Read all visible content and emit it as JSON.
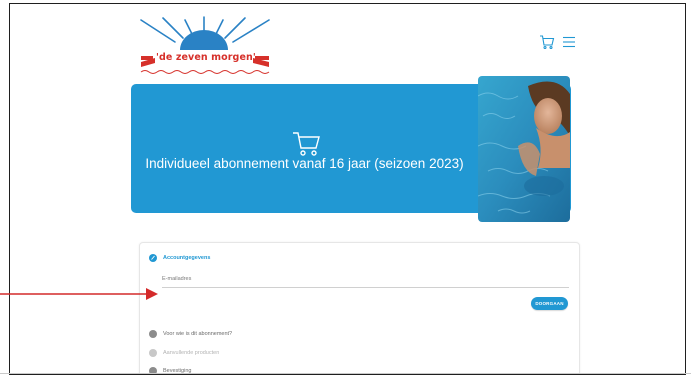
{
  "brand": {
    "name": "'de zeven morgen'",
    "primary_color": "#2198d3",
    "logo_red": "#d6302a",
    "logo_blue": "#2a82c5"
  },
  "header": {
    "icons": [
      "cart-icon",
      "menu-icon"
    ]
  },
  "hero": {
    "title": "Individueel abonnement vanaf 16 jaar (seizoen 2023)",
    "icon": "cart-icon"
  },
  "form": {
    "steps": [
      {
        "label": "Accountgegevens",
        "state": "active"
      },
      {
        "label": "Voor wie is dit abonnement?",
        "state": "pending"
      },
      {
        "label": "Aanvullende producten",
        "state": "disabled"
      },
      {
        "label": "Bevestiging",
        "state": "pending"
      }
    ],
    "email_placeholder": "E-mailadres",
    "next_button": "DOORGAAN"
  },
  "annotation": {
    "arrow_color": "#d42a2a",
    "points_to": "email-field"
  }
}
